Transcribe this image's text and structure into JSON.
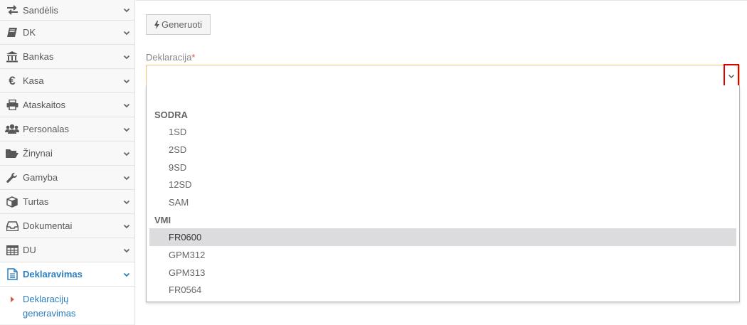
{
  "sidebar": {
    "items": [
      {
        "label": "Sandėlis",
        "icon": "exchange-icon"
      },
      {
        "label": "DK",
        "icon": "book-icon"
      },
      {
        "label": "Bankas",
        "icon": "bank-icon"
      },
      {
        "label": "Kasa",
        "icon": "euro-icon"
      },
      {
        "label": "Ataskaitos",
        "icon": "print-icon"
      },
      {
        "label": "Personalas",
        "icon": "users-icon"
      },
      {
        "label": "Žinynai",
        "icon": "folder-open-icon"
      },
      {
        "label": "Gamyba",
        "icon": "wrench-icon"
      },
      {
        "label": "Turtas",
        "icon": "cube-icon"
      },
      {
        "label": "Dokumentai",
        "icon": "inbox-icon"
      },
      {
        "label": "DU",
        "icon": "table-icon"
      },
      {
        "label": "Deklaravimas",
        "icon": "file-text-icon"
      }
    ],
    "active_item": "Deklaravimas",
    "submenu": {
      "line1": "Deklaracijų",
      "line2": "generavimas"
    }
  },
  "toolbar": {
    "generate_label": "Generuoti"
  },
  "form": {
    "declaration_label": "Deklaracija",
    "required_mark": "*",
    "selected_value": ""
  },
  "dropdown": {
    "groups": [
      {
        "name": "SODRA",
        "options": [
          "1SD",
          "2SD",
          "9SD",
          "12SD",
          "SAM"
        ]
      },
      {
        "name": "VMI",
        "options": [
          "FR0600",
          "GPM312",
          "GPM313",
          "FR0564"
        ]
      }
    ],
    "highlighted": "FR0600"
  },
  "colors": {
    "accent": "#2b7dbc",
    "required": "#d15b47",
    "highlight_box": "#e00000"
  }
}
